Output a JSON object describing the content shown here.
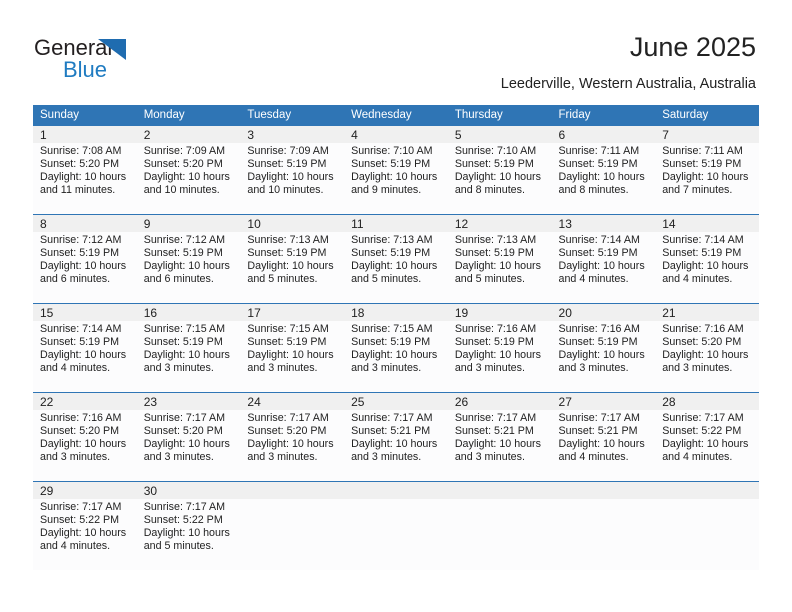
{
  "brand": {
    "name_top": "General",
    "name_bottom": "Blue",
    "triangle_color": "#1f6cb0",
    "text_color": "#231f20",
    "blue_color": "#1f7bc1"
  },
  "header": {
    "title": "June 2025",
    "subtitle": "Leederville, Western Australia, Australia"
  },
  "theme": {
    "header_bg": "#2f75b5",
    "header_text": "#ffffff",
    "daynum_bg": "#f0f0f0",
    "cell_bg": "#fcfcfd",
    "row_divider": "#2f75b5"
  },
  "calendar": {
    "weekday_headers": [
      "Sunday",
      "Monday",
      "Tuesday",
      "Wednesday",
      "Thursday",
      "Friday",
      "Saturday"
    ],
    "weeks": [
      [
        {
          "day": "1",
          "sunrise": "Sunrise: 7:08 AM",
          "sunset": "Sunset: 5:20 PM",
          "daylight": "Daylight: 10 hours and 11 minutes."
        },
        {
          "day": "2",
          "sunrise": "Sunrise: 7:09 AM",
          "sunset": "Sunset: 5:20 PM",
          "daylight": "Daylight: 10 hours and 10 minutes."
        },
        {
          "day": "3",
          "sunrise": "Sunrise: 7:09 AM",
          "sunset": "Sunset: 5:19 PM",
          "daylight": "Daylight: 10 hours and 10 minutes."
        },
        {
          "day": "4",
          "sunrise": "Sunrise: 7:10 AM",
          "sunset": "Sunset: 5:19 PM",
          "daylight": "Daylight: 10 hours and 9 minutes."
        },
        {
          "day": "5",
          "sunrise": "Sunrise: 7:10 AM",
          "sunset": "Sunset: 5:19 PM",
          "daylight": "Daylight: 10 hours and 8 minutes."
        },
        {
          "day": "6",
          "sunrise": "Sunrise: 7:11 AM",
          "sunset": "Sunset: 5:19 PM",
          "daylight": "Daylight: 10 hours and 8 minutes."
        },
        {
          "day": "7",
          "sunrise": "Sunrise: 7:11 AM",
          "sunset": "Sunset: 5:19 PM",
          "daylight": "Daylight: 10 hours and 7 minutes."
        }
      ],
      [
        {
          "day": "8",
          "sunrise": "Sunrise: 7:12 AM",
          "sunset": "Sunset: 5:19 PM",
          "daylight": "Daylight: 10 hours and 6 minutes."
        },
        {
          "day": "9",
          "sunrise": "Sunrise: 7:12 AM",
          "sunset": "Sunset: 5:19 PM",
          "daylight": "Daylight: 10 hours and 6 minutes."
        },
        {
          "day": "10",
          "sunrise": "Sunrise: 7:13 AM",
          "sunset": "Sunset: 5:19 PM",
          "daylight": "Daylight: 10 hours and 5 minutes."
        },
        {
          "day": "11",
          "sunrise": "Sunrise: 7:13 AM",
          "sunset": "Sunset: 5:19 PM",
          "daylight": "Daylight: 10 hours and 5 minutes."
        },
        {
          "day": "12",
          "sunrise": "Sunrise: 7:13 AM",
          "sunset": "Sunset: 5:19 PM",
          "daylight": "Daylight: 10 hours and 5 minutes."
        },
        {
          "day": "13",
          "sunrise": "Sunrise: 7:14 AM",
          "sunset": "Sunset: 5:19 PM",
          "daylight": "Daylight: 10 hours and 4 minutes."
        },
        {
          "day": "14",
          "sunrise": "Sunrise: 7:14 AM",
          "sunset": "Sunset: 5:19 PM",
          "daylight": "Daylight: 10 hours and 4 minutes."
        }
      ],
      [
        {
          "day": "15",
          "sunrise": "Sunrise: 7:14 AM",
          "sunset": "Sunset: 5:19 PM",
          "daylight": "Daylight: 10 hours and 4 minutes."
        },
        {
          "day": "16",
          "sunrise": "Sunrise: 7:15 AM",
          "sunset": "Sunset: 5:19 PM",
          "daylight": "Daylight: 10 hours and 3 minutes."
        },
        {
          "day": "17",
          "sunrise": "Sunrise: 7:15 AM",
          "sunset": "Sunset: 5:19 PM",
          "daylight": "Daylight: 10 hours and 3 minutes."
        },
        {
          "day": "18",
          "sunrise": "Sunrise: 7:15 AM",
          "sunset": "Sunset: 5:19 PM",
          "daylight": "Daylight: 10 hours and 3 minutes."
        },
        {
          "day": "19",
          "sunrise": "Sunrise: 7:16 AM",
          "sunset": "Sunset: 5:19 PM",
          "daylight": "Daylight: 10 hours and 3 minutes."
        },
        {
          "day": "20",
          "sunrise": "Sunrise: 7:16 AM",
          "sunset": "Sunset: 5:19 PM",
          "daylight": "Daylight: 10 hours and 3 minutes."
        },
        {
          "day": "21",
          "sunrise": "Sunrise: 7:16 AM",
          "sunset": "Sunset: 5:20 PM",
          "daylight": "Daylight: 10 hours and 3 minutes."
        }
      ],
      [
        {
          "day": "22",
          "sunrise": "Sunrise: 7:16 AM",
          "sunset": "Sunset: 5:20 PM",
          "daylight": "Daylight: 10 hours and 3 minutes."
        },
        {
          "day": "23",
          "sunrise": "Sunrise: 7:17 AM",
          "sunset": "Sunset: 5:20 PM",
          "daylight": "Daylight: 10 hours and 3 minutes."
        },
        {
          "day": "24",
          "sunrise": "Sunrise: 7:17 AM",
          "sunset": "Sunset: 5:20 PM",
          "daylight": "Daylight: 10 hours and 3 minutes."
        },
        {
          "day": "25",
          "sunrise": "Sunrise: 7:17 AM",
          "sunset": "Sunset: 5:21 PM",
          "daylight": "Daylight: 10 hours and 3 minutes."
        },
        {
          "day": "26",
          "sunrise": "Sunrise: 7:17 AM",
          "sunset": "Sunset: 5:21 PM",
          "daylight": "Daylight: 10 hours and 3 minutes."
        },
        {
          "day": "27",
          "sunrise": "Sunrise: 7:17 AM",
          "sunset": "Sunset: 5:21 PM",
          "daylight": "Daylight: 10 hours and 4 minutes."
        },
        {
          "day": "28",
          "sunrise": "Sunrise: 7:17 AM",
          "sunset": "Sunset: 5:22 PM",
          "daylight": "Daylight: 10 hours and 4 minutes."
        }
      ],
      [
        {
          "day": "29",
          "sunrise": "Sunrise: 7:17 AM",
          "sunset": "Sunset: 5:22 PM",
          "daylight": "Daylight: 10 hours and 4 minutes."
        },
        {
          "day": "30",
          "sunrise": "Sunrise: 7:17 AM",
          "sunset": "Sunset: 5:22 PM",
          "daylight": "Daylight: 10 hours and 5 minutes."
        },
        {
          "day": "",
          "sunrise": "",
          "sunset": "",
          "daylight": ""
        },
        {
          "day": "",
          "sunrise": "",
          "sunset": "",
          "daylight": ""
        },
        {
          "day": "",
          "sunrise": "",
          "sunset": "",
          "daylight": ""
        },
        {
          "day": "",
          "sunrise": "",
          "sunset": "",
          "daylight": ""
        },
        {
          "day": "",
          "sunrise": "",
          "sunset": "",
          "daylight": ""
        }
      ]
    ]
  }
}
